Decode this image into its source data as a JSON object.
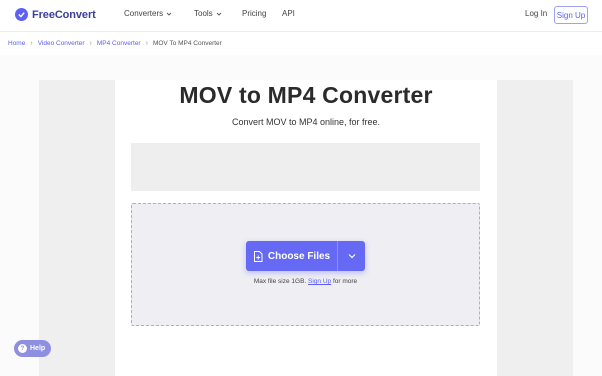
{
  "brand": {
    "name": "FreeConvert",
    "accent": "#5c60f5"
  },
  "nav": {
    "items": [
      {
        "label": "Converters",
        "has_dropdown": true
      },
      {
        "label": "Tools",
        "has_dropdown": true
      },
      {
        "label": "Pricing",
        "has_dropdown": false
      },
      {
        "label": "API",
        "has_dropdown": false
      }
    ],
    "login": "Log In",
    "signup": "Sign Up"
  },
  "breadcrumb": [
    "Home",
    "Video Converter",
    "MP4 Converter",
    "MOV To MP4 Converter"
  ],
  "hero": {
    "title": "MOV to MP4 Converter",
    "subtitle": "Convert MOV to MP4 online, for free."
  },
  "upload": {
    "button_label": "Choose Files",
    "max_size_prefix": "Max file size 1GB.",
    "max_size_link": "Sign Up",
    "max_size_suffix": "for more"
  },
  "help": {
    "label": "Help"
  }
}
